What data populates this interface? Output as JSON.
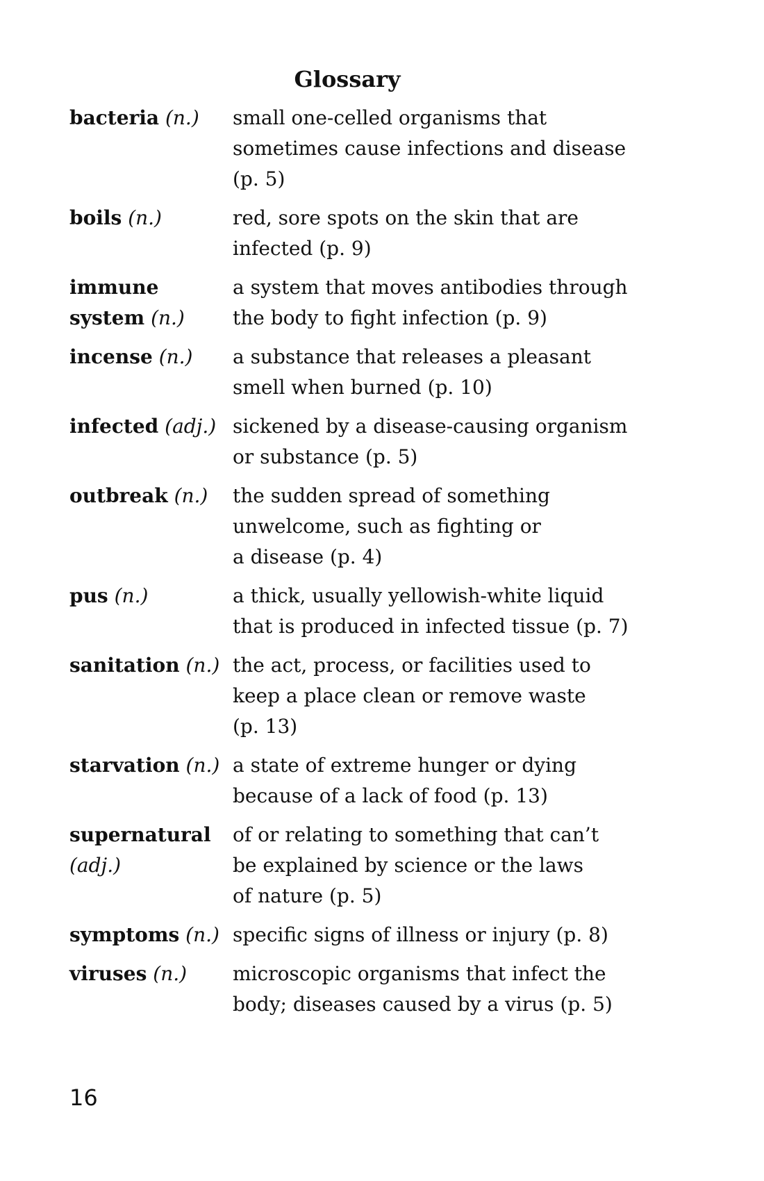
{
  "title": "Glossary",
  "entries": [
    {
      "term": "bacteria",
      "pos": "(n.)",
      "definition": [
        "small one-celled organisms that",
        "sometimes cause infections and disease",
        "(p. 5)"
      ]
    },
    {
      "term": "boils",
      "pos": "(n.)",
      "definition": [
        "red, sore spots on the skin that are",
        "infected (p. 9)"
      ]
    },
    {
      "term": "immune system",
      "pos": "(n.)",
      "definition": [
        "a system that moves antibodies through",
        "the body to fight infection (p. 9)"
      ]
    },
    {
      "term": "incense",
      "pos": "(n.)",
      "definition": [
        "a substance that releases a pleasant",
        "smell when burned (p. 10)"
      ]
    },
    {
      "term": "infected",
      "pos": "(adj.)",
      "definition": [
        "sickened by a disease-causing organism",
        "or substance (p. 5)"
      ]
    },
    {
      "term": "outbreak",
      "pos": "(n.)",
      "definition": [
        "the sudden spread of something",
        "unwelcome, such as fighting or",
        "a disease (p. 4)"
      ]
    },
    {
      "term": "pus",
      "pos": "(n.)",
      "definition": [
        "a thick, usually yellowish-white liquid",
        "that is produced in infected tissue (p. 7)"
      ]
    },
    {
      "term": "sanitation",
      "pos": "(n.)",
      "definition": [
        "the act, process, or facilities used to",
        "keep a place clean or remove waste",
        "(p. 13)"
      ]
    },
    {
      "term": "starvation",
      "pos": "(n.)",
      "definition": [
        "a state of extreme hunger or dying",
        "because of a lack of food (p. 13)"
      ]
    },
    {
      "term": "supernatural",
      "pos": "(adj.)",
      "definition": [
        "of or relating to something that can’t",
        "be explained by science or the laws",
        "of nature (p. 5)"
      ]
    },
    {
      "term": "symptoms",
      "pos": "(n.)",
      "definition": [
        "specific signs of illness or injury (p. 8)"
      ]
    },
    {
      "term": "viruses",
      "pos": "(n.)",
      "definition": [
        "microscopic organisms that infect the",
        "body; diseases caused by a virus (p. 5)"
      ]
    }
  ],
  "page_number": "16"
}
